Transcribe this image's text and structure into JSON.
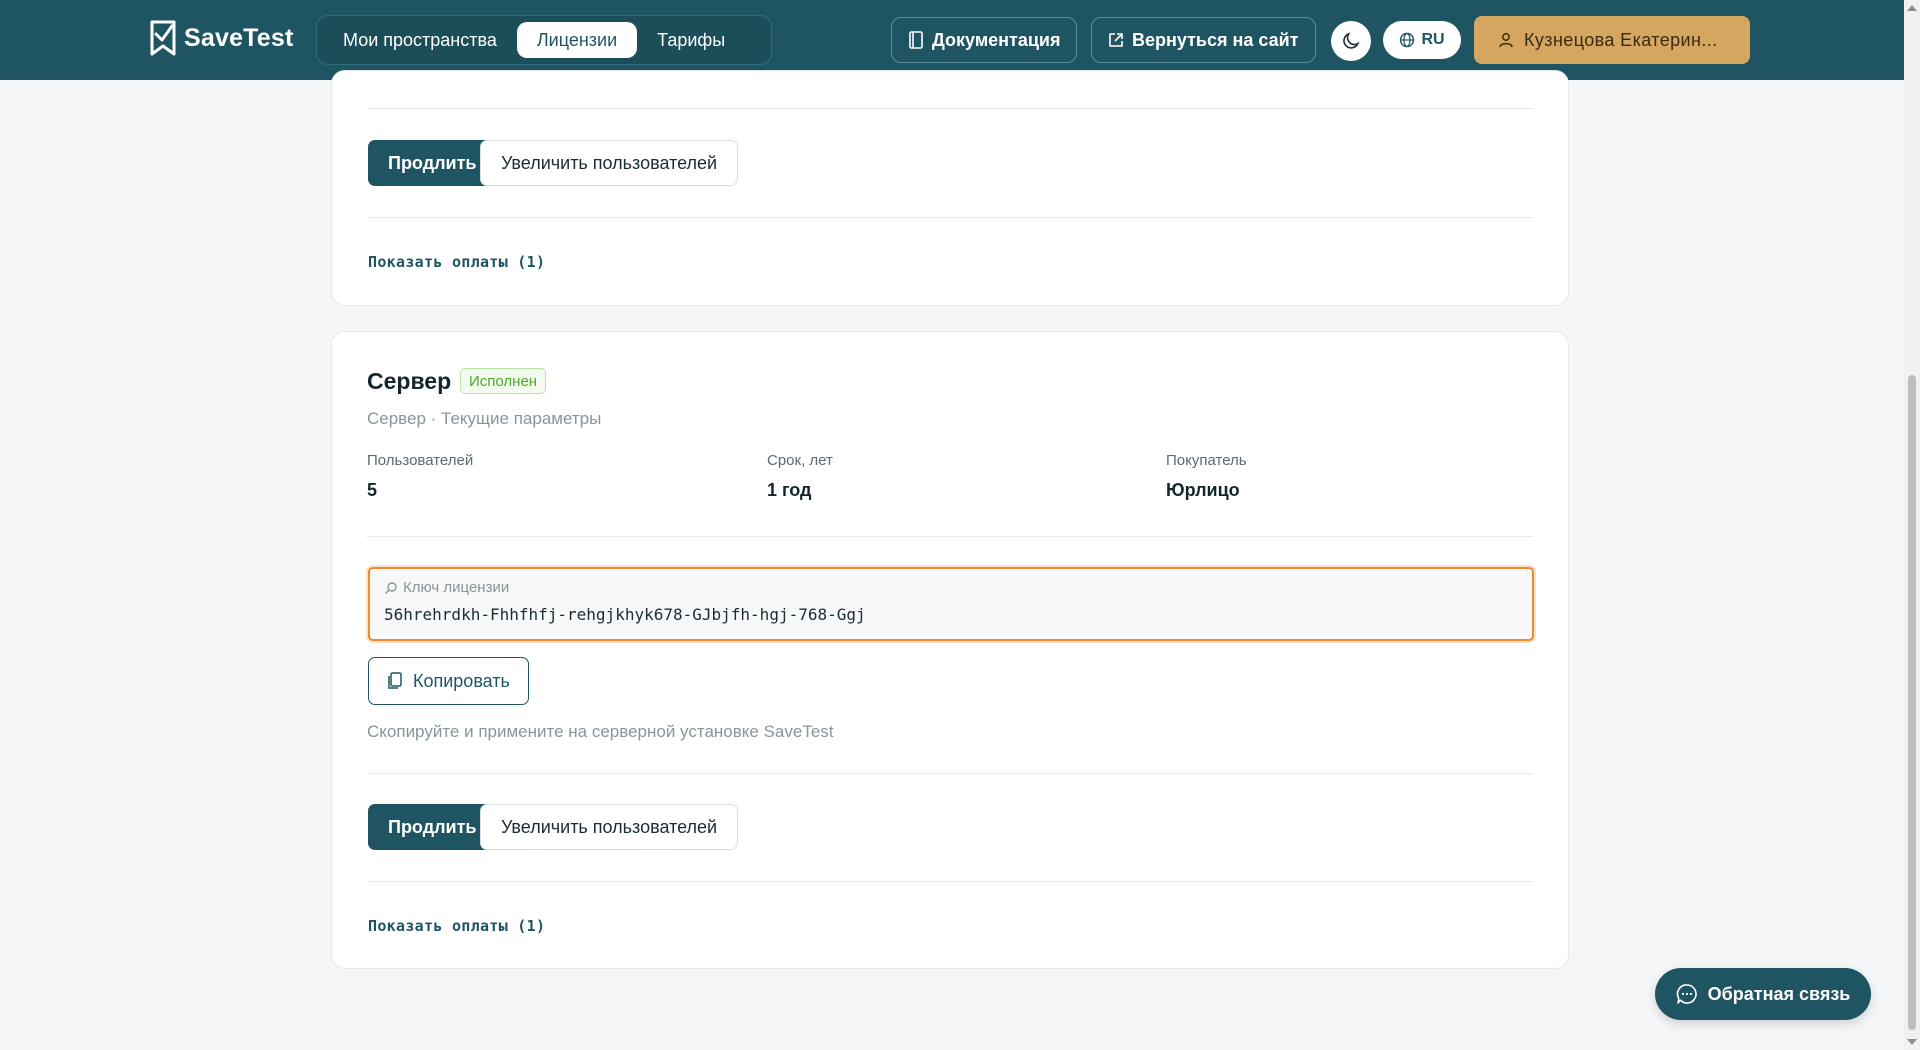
{
  "header": {
    "brand": "SaveTest",
    "tabs": [
      {
        "label": "Мои пространства"
      },
      {
        "label": "Лицензии"
      },
      {
        "label": "Тарифы"
      }
    ],
    "docs_label": "Документация",
    "back_label": "Вернуться на сайт",
    "lang_label": "RU",
    "user_label": "Кузнецова  Екатерин..."
  },
  "license_top": {
    "renew_label": "Продлить",
    "increase_label": "Увеличить пользователей",
    "payments_label": "Показать оплаты (1)"
  },
  "license_server": {
    "title": "Сервер",
    "status": "Исполнен",
    "subtitle": "Сервер · Текущие параметры",
    "stats": [
      {
        "label": "Пользователей",
        "value": "5"
      },
      {
        "label": "Срок, лет",
        "value": "1 год"
      },
      {
        "label": "Покупатель",
        "value": "Юрлицо"
      }
    ],
    "key_label": "Ключ лицензии",
    "key_value": "56hrehrdkh-Fhhfhfj-rehgjkhyk678-GJbjfh-hgj-768-Ggj",
    "copy_label": "Копировать",
    "hint": "Скопируйте и примените на серверной установке SaveTest",
    "renew_label": "Продлить",
    "increase_label": "Увеличить пользователей",
    "payments_label": "Показать оплаты (1)"
  },
  "feedback_label": "Обратная связь",
  "colors": {
    "primary": "#1f5562",
    "user_accent": "#d4a65f",
    "success": "#4caa2b",
    "focus": "#ef8a2f"
  }
}
